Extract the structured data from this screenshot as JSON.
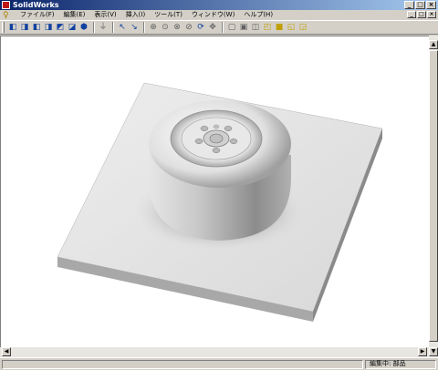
{
  "window": {
    "title": "SolidWorks"
  },
  "window_controls": {
    "minimize": "_",
    "maximize": "□",
    "close": "×"
  },
  "menubar": {
    "items": [
      "ファイル(F)",
      "編集(E)",
      "表示(V)",
      "挿入(I)",
      "ツール(T)",
      "ウィンドウ(W)",
      "ヘルプ(H)"
    ]
  },
  "toolbar": {
    "groups": [
      [
        "view-front-icon",
        "view-back-icon",
        "view-left-icon",
        "view-right-icon",
        "view-top-icon",
        "view-bottom-icon",
        "view-isometric-icon"
      ],
      [
        "normal-to-icon"
      ],
      [
        "select-icon",
        "select-edge-icon",
        "zoom-to-fit-icon",
        "zoom-to-area-icon",
        "zoom-in-out-icon",
        "zoom-to-selection-icon",
        "rotate-view-icon",
        "pan-icon"
      ],
      [
        "wireframe-icon",
        "hidden-lines-visible-icon",
        "hidden-lines-removed-icon",
        "shaded-with-edges-icon",
        "shaded-icon",
        "perspective-icon",
        "section-view-icon"
      ]
    ]
  },
  "statusbar": {
    "text": "編集中: 部品"
  },
  "colors": {
    "title_start": "#0a246a",
    "title_end": "#a6caf0",
    "viewport_bg": "#ffffff",
    "model_top": "#e2e2e2",
    "model_side": "#a8a8a8"
  }
}
